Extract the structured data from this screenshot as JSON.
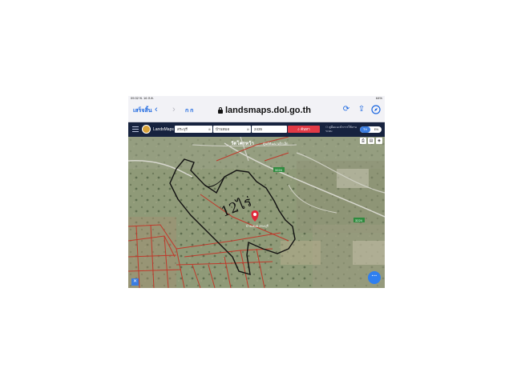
{
  "status_bar": {
    "time": "09:32",
    "date": "พ. 16 ส.ค.",
    "right": "64%"
  },
  "browser": {
    "done_label": "เสร็จสิ้น",
    "back_glyph": "‹",
    "forward_glyph": "›",
    "reader_label": "ก ก",
    "url": "landsmaps.dol.go.th"
  },
  "app": {
    "name": "LandsMaps",
    "province": "สระบุรี",
    "district": "บ้านหมอ",
    "parcel_number": "2435",
    "search_label": "ค้นหา",
    "help_label": "คู่มือแนะนำการใช้งานระบบ",
    "lang_th": "TH",
    "lang_en": "EN"
  },
  "map": {
    "road_label_top": "วัดโคกหว้า",
    "road_label_top2": "ศูนย์พัฒนาเด็กเล็ก",
    "road_sign_1": "3224",
    "road_sign_2": "3224",
    "marker_label": "บ้านหมอ สระบุรี",
    "handwritten_note": "12ไร่"
  },
  "colors": {
    "browser_accent": "#1a66e0",
    "header_bg": "#17233f",
    "search_button": "#e23a46",
    "parcel_lines": "#c0392b",
    "outline": "#111111",
    "marker": "#e02a3a",
    "fab": "#2f7ff0"
  }
}
